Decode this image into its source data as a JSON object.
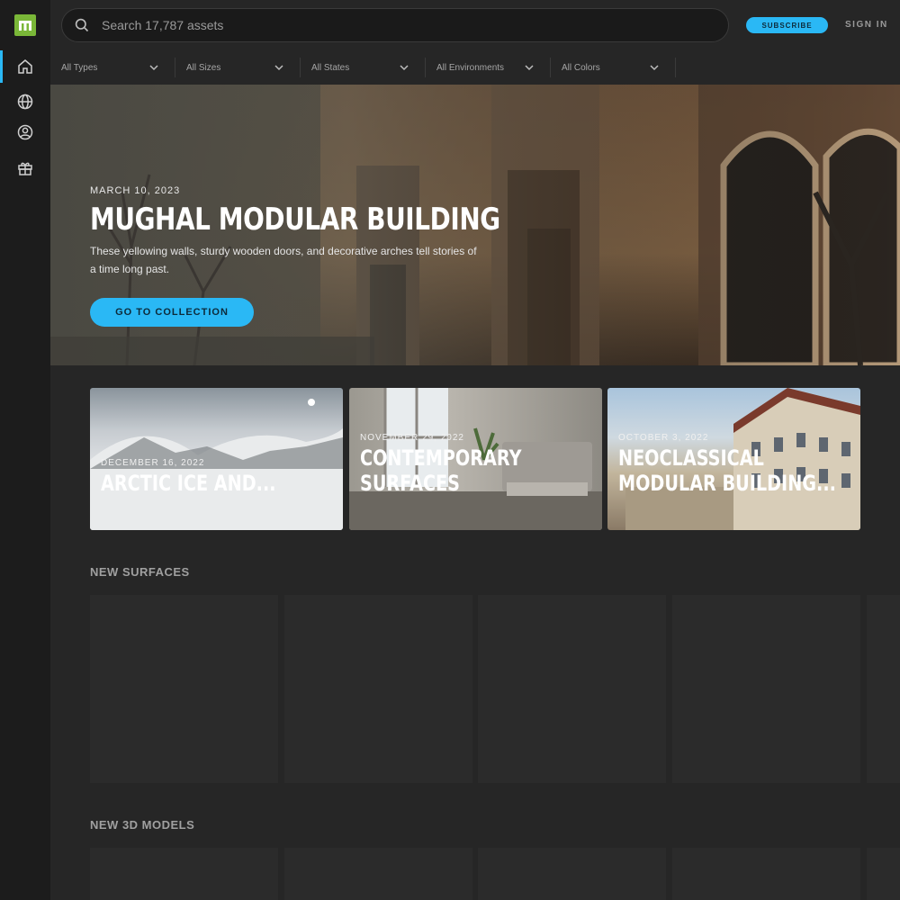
{
  "search": {
    "placeholder": "Search 17,787 assets"
  },
  "header": {
    "subscribe_label": "SUBSCRIBE",
    "signin_label": "SIGN IN"
  },
  "sidebar": {
    "items": [
      "home-icon",
      "globe-icon",
      "user-icon",
      "gift-icon"
    ],
    "active": 0
  },
  "filters": [
    "All Types",
    "All Sizes",
    "All States",
    "All Environments",
    "All Colors"
  ],
  "hero": {
    "date": "MARCH 10, 2023",
    "title": "MUGHAL MODULAR BUILDING",
    "description": "These yellowing walls, sturdy wooden doors, and decorative arches tell stories of a time long past.",
    "button_label": "GO TO COLLECTION"
  },
  "collections": [
    {
      "date": "DECEMBER 16, 2022",
      "title_lines": [
        "ARCTIC ICE AND..."
      ]
    },
    {
      "date": "NOVEMBER 29, 2022",
      "title_lines": [
        "CONTEMPORARY",
        "SURFACES"
      ]
    },
    {
      "date": "OCTOBER 3, 2022",
      "title_lines": [
        "NEOCLASSICAL",
        "MODULAR BUILDING..."
      ]
    }
  ],
  "sections": {
    "surfaces_title": "NEW SURFACES",
    "models_title": "NEW 3D MODELS"
  },
  "colors": {
    "accent": "#2ab8f5",
    "logo": "#7ab738",
    "background": "#262626",
    "sidebar": "#1c1c1c"
  }
}
